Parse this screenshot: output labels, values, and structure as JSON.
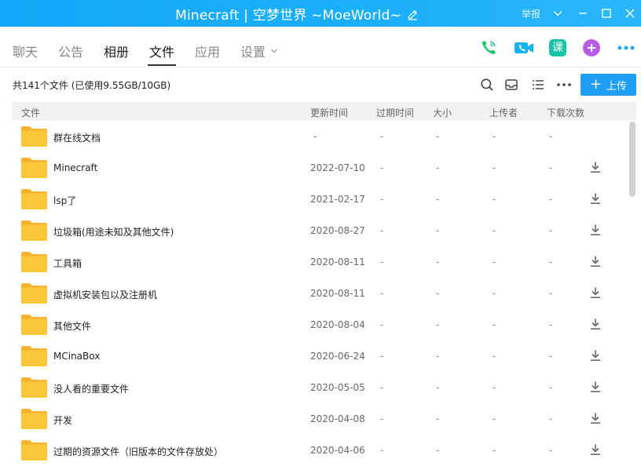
{
  "window": {
    "title": "Minecraft | 空梦世界 ~MoeWorld~",
    "report_label": "举报"
  },
  "tabs": [
    {
      "label": "聊天",
      "active": false
    },
    {
      "label": "公告",
      "active": false
    },
    {
      "label": "相册",
      "active": false
    },
    {
      "label": "文件",
      "active": true
    },
    {
      "label": "应用",
      "active": false
    },
    {
      "label": "设置",
      "active": false
    }
  ],
  "apps": {
    "ke_label": "课",
    "phone_icon": "phone-icon",
    "video_icon": "video-camera-icon",
    "add_icon": "plus-circle-icon",
    "more_icon": "more-dots-icon"
  },
  "toolbar": {
    "summary": "共141个文件 (已使用9.55GB/10GB)",
    "upload_label": "上传",
    "upload_plus": "+"
  },
  "table": {
    "headers": {
      "file": "文件",
      "updated": "更新时间",
      "expires": "过期时间",
      "size": "大小",
      "uploader": "上传者",
      "downloads": "下载次数"
    },
    "rows": [
      {
        "name": "群在线文档",
        "updated": "-",
        "expires": "-",
        "size": "-",
        "uploader": "-",
        "downloads": "-",
        "downloadable": false
      },
      {
        "name": "Minecraft",
        "updated": "2022-07-10",
        "expires": "-",
        "size": "-",
        "uploader": "-",
        "downloads": "-",
        "downloadable": true
      },
      {
        "name": "lsp了",
        "updated": "2021-02-17",
        "expires": "-",
        "size": "-",
        "uploader": "-",
        "downloads": "-",
        "downloadable": true
      },
      {
        "name": "垃圾箱(用途未知及其他文件)",
        "updated": "2020-08-27",
        "expires": "-",
        "size": "-",
        "uploader": "-",
        "downloads": "-",
        "downloadable": true
      },
      {
        "name": "工具箱",
        "updated": "2020-08-11",
        "expires": "-",
        "size": "-",
        "uploader": "-",
        "downloads": "-",
        "downloadable": true
      },
      {
        "name": "虚拟机安装包以及注册机",
        "updated": "2020-08-11",
        "expires": "-",
        "size": "-",
        "uploader": "-",
        "downloads": "-",
        "downloadable": true
      },
      {
        "name": "其他文件",
        "updated": "2020-08-04",
        "expires": "-",
        "size": "-",
        "uploader": "-",
        "downloads": "-",
        "downloadable": true
      },
      {
        "name": "MCinaBox",
        "updated": "2020-06-24",
        "expires": "-",
        "size": "-",
        "uploader": "-",
        "downloads": "-",
        "downloadable": true
      },
      {
        "name": "没人看的重要文件",
        "updated": "2020-05-05",
        "expires": "-",
        "size": "-",
        "uploader": "-",
        "downloads": "-",
        "downloadable": true
      },
      {
        "name": "开发",
        "updated": "2020-04-08",
        "expires": "-",
        "size": "-",
        "uploader": "-",
        "downloads": "-",
        "downloadable": true
      },
      {
        "name": "过期的资源文件（旧版本的文件存放处）",
        "updated": "2020-04-06",
        "expires": "-",
        "size": "-",
        "uploader": "-",
        "downloads": "-",
        "downloadable": true
      }
    ]
  },
  "colors": {
    "titlebar": "#1aaefa",
    "accent": "#1e9ef5",
    "folder": "#fcc63a",
    "phone": "#16c86e",
    "video": "#13b3f0",
    "ke": "#18c3a6",
    "add": "#b85ee6"
  }
}
